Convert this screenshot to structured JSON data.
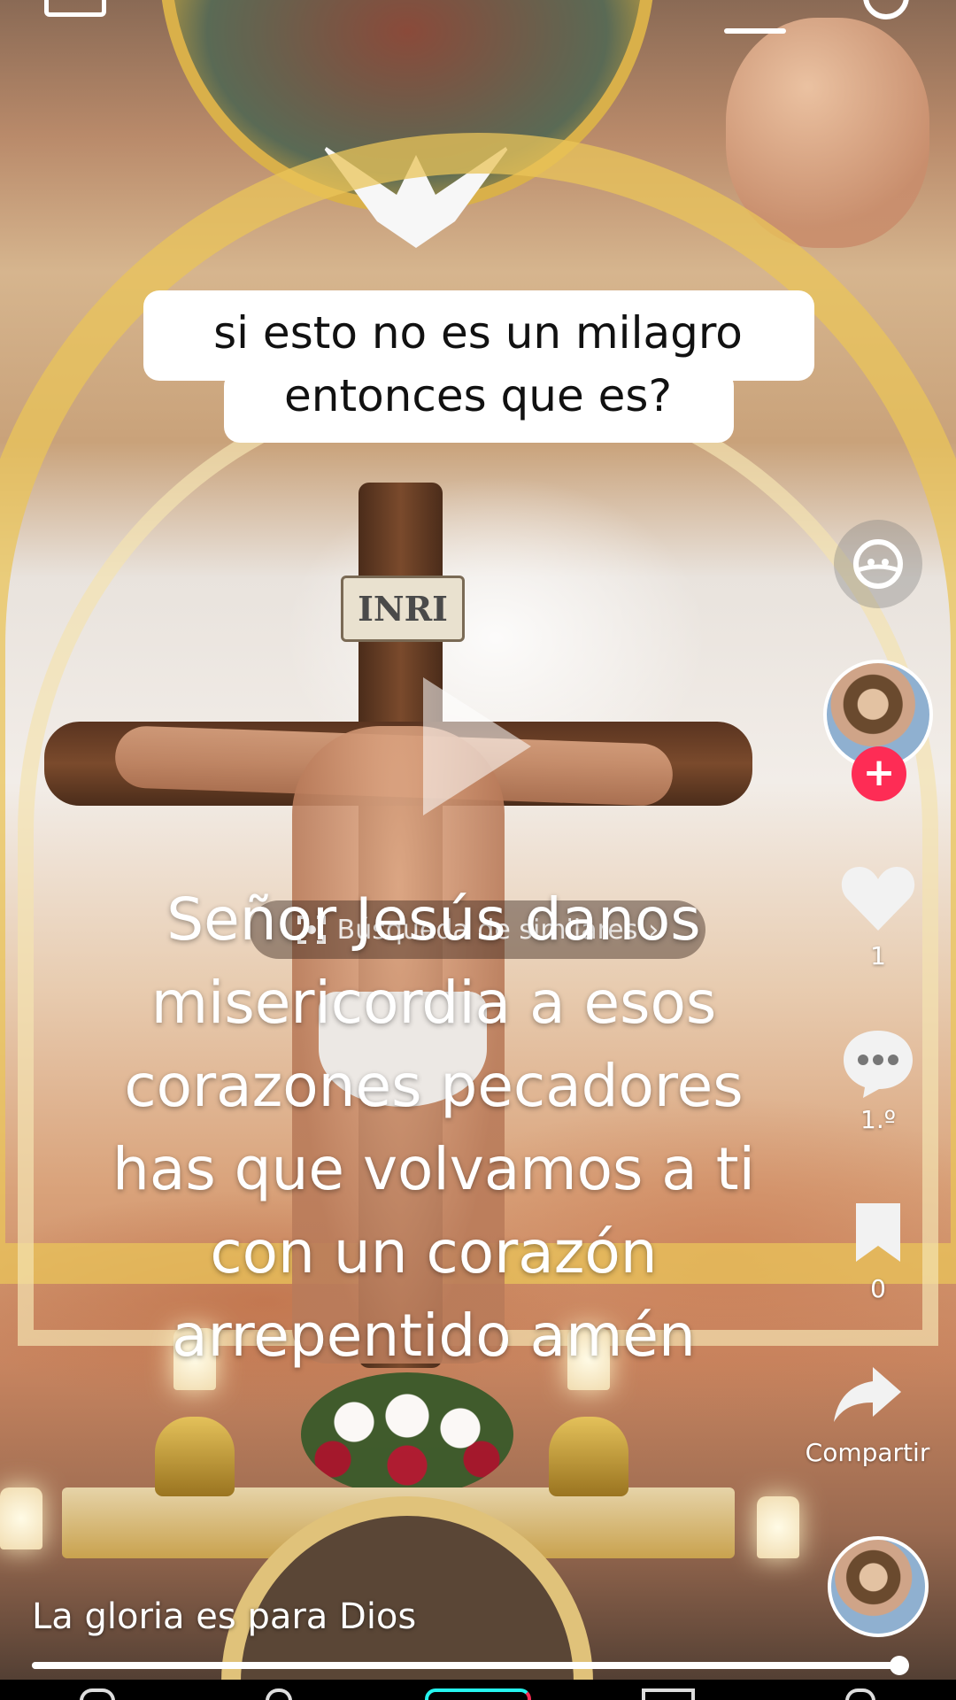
{
  "caption": {
    "line1": "si esto no es un milagro",
    "line2": "entonces que es?"
  },
  "scene": {
    "cross_sign": "INRI"
  },
  "search_similar": {
    "label": "Búsqueda de similares"
  },
  "overlay_text": "Señor Jesús danos\nmisericordia a esos\ncorazones pecadores\nhas que volvamos a ti\ncon un corazón\narrepentido amén",
  "rail": {
    "likes": "1",
    "comments": "1.º",
    "saves": "0",
    "share_label": "Compartir"
  },
  "author": {
    "name": "La gloria es para Dios"
  },
  "playback": {
    "progress_fraction": 0.99
  },
  "colors": {
    "accent_follow": "#fe2c55",
    "text": "#ffffff"
  }
}
